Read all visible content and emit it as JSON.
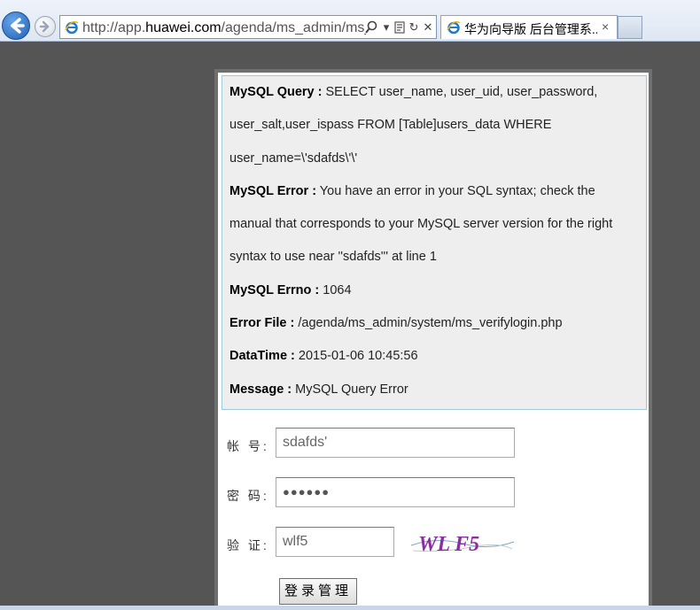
{
  "browser": {
    "url_prefix": "http://app.",
    "url_domain": "huawei.com",
    "url_path": "/agenda/ms_admin/ms_",
    "tab_title": "华为向导版 后台管理系...",
    "tab_close": "×",
    "addr_search_icon": "search-icon",
    "addr_dropdown": "▾",
    "addr_refresh": "↻",
    "addr_stop": "✕"
  },
  "error": {
    "query_label": "MySQL Query :",
    "query_value": " SELECT user_name, user_uid, user_password, user_salt,user_ispass FROM [Table]users_data WHERE user_name=\\'sdafds\\'\\'",
    "error_label": "MySQL Error :",
    "error_value": " You have an error in your SQL syntax; check the manual that corresponds to your MySQL server version for the right syntax to use near ''sdafds''' at line 1",
    "errno_label": "MySQL Errno :",
    "errno_value": " 1064",
    "file_label": "Error File :",
    "file_value": " /agenda/ms_admin/system/ms_verifylogin.php",
    "time_label": "DataTime :",
    "time_value": " 2015-01-06 10:45:56",
    "message_label": "Message :",
    "message_value": " MySQL Query Error"
  },
  "form": {
    "account_label": "帐 号:",
    "account_value": "sdafds'",
    "password_label": "密 码:",
    "password_value": "●●●●●●",
    "captcha_label": "验 证:",
    "captcha_value": "wlf5",
    "captcha_image_text": "WL F5",
    "submit_label": "登录管理"
  },
  "colors": {
    "page_background": "#555555",
    "error_box_background": "#eeeeee",
    "error_box_border": "#9ecadb"
  }
}
